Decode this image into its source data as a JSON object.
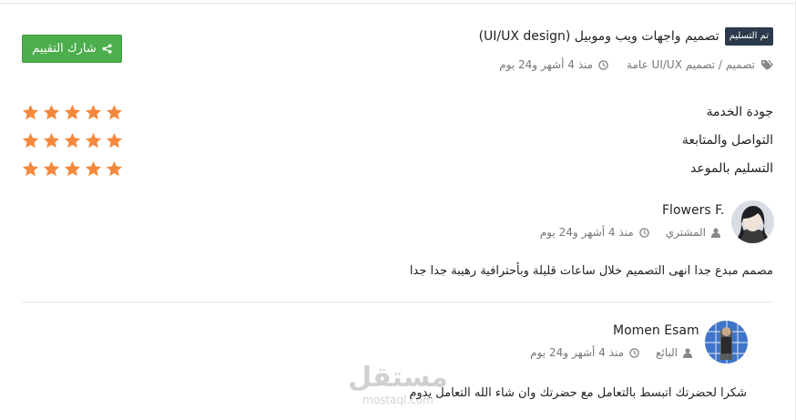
{
  "project": {
    "status_badge": "تم التسليم",
    "title": "تصميم واجهات ويب وموبيل (UI/UX design)",
    "category_path": "تصميم / تصميم UI/UX عامة",
    "time_ago": "منذ 4 أشهر و24 يوم",
    "share_button": "شارك التقييم"
  },
  "ratings": [
    {
      "label": "جودة الخدمة",
      "stars": 5
    },
    {
      "label": "التواصل والمتابعة",
      "stars": 5
    },
    {
      "label": "التسليم بالموعد",
      "stars": 5
    }
  ],
  "buyer_review": {
    "name": "Flowers F.",
    "role": "المشتري",
    "time_ago": "منذ 4 أشهر و24 يوم",
    "comment": "مصمم مبدع جدا انهى التصميم خلال ساعات قليلة وبأحترافية رهيبة جدا جدا"
  },
  "seller_reply": {
    "name": "Momen Esam",
    "role": "البائع",
    "time_ago": "منذ 4 أشهر و24 يوم",
    "comment": "شكرا لحضرتك اتبسط بالتعامل مع حضرتك وان شاء الله التعامل يدوم"
  },
  "watermark": {
    "main": "مستقل",
    "sub": "mostaql.com"
  },
  "colors": {
    "star": "#f5883c",
    "share_button": "#4cae4c",
    "badge": "#2b3a4a"
  }
}
